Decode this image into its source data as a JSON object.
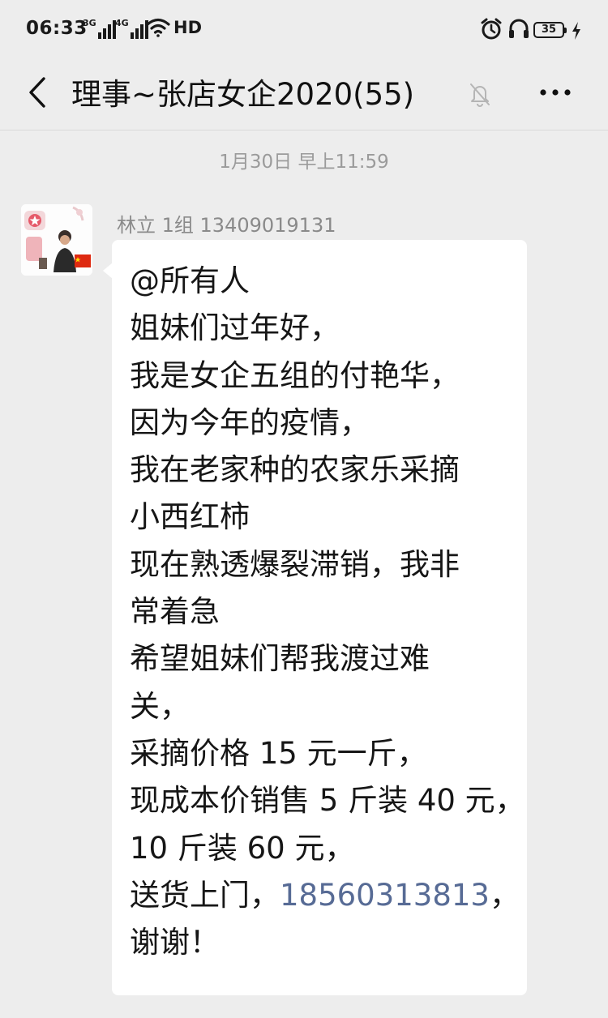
{
  "status_bar": {
    "time": "06:33",
    "network_1": "3G",
    "network_2": "4G",
    "hd": "HD",
    "battery": "35",
    "icons": [
      "signal-icon",
      "wifi-icon",
      "alarm-icon",
      "headset-icon",
      "battery-icon",
      "charging-icon"
    ]
  },
  "header": {
    "title": "理事~张店女企2020(55)",
    "icons": [
      "back-icon",
      "mute-icon",
      "more-icon"
    ]
  },
  "timestamp": "1月30日 早上11:59",
  "message": {
    "sender": "林立 1组 13409019131",
    "lines": {
      "l1": "@所有人",
      "l2": "姐妹们过年好，",
      "l3": "我是女企五组的付艳华，",
      "l4": "因为今年的疫情，",
      "l5": "我在老家种的农家乐采摘",
      "l6": "小西红柿",
      "l7": "现在熟透爆裂滞销，我非",
      "l8": "常着急",
      "l9": "希望姐妹们帮我渡过难",
      "l10": "关，",
      "l11": "采摘价格 15 元一斤，",
      "l12": "现成本价销售 5 斤装 40 元，",
      "l13": "10 斤装 60 元，",
      "l14_prefix": "送货上门，",
      "l14_phone": "18560313813",
      "l14_suffix": "，",
      "l15": "谢谢！"
    }
  },
  "colors": {
    "background": "#ededed",
    "bubble": "#ffffff",
    "link": "#576b95",
    "meta_text": "#9b9b9b"
  }
}
